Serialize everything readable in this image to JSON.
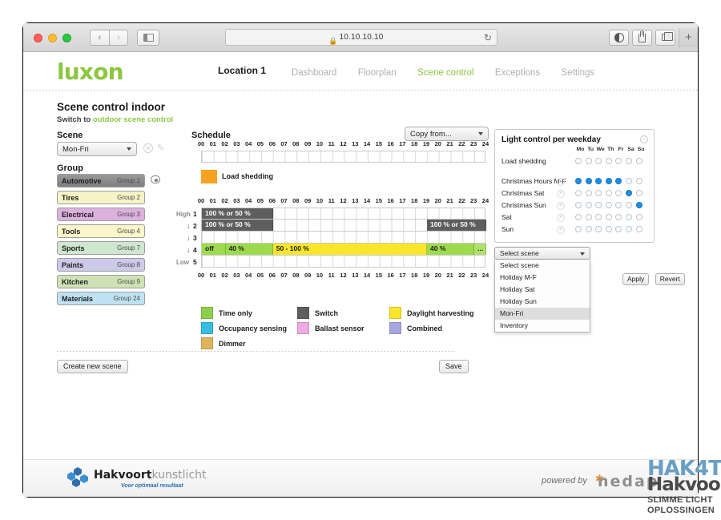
{
  "browser": {
    "url": "10.10.10.10",
    "lock_icon": "lock-icon",
    "reload_icon": "reload-icon",
    "back_icon": "chevron-left-icon",
    "forward_icon": "chevron-right-icon",
    "sidebar_icon": "sidebar-icon",
    "reader_icon": "reader-icon",
    "share_icon": "share-icon",
    "tabs_icon": "tab-overview-icon",
    "newtab_label": "+"
  },
  "header": {
    "logo": "luxon",
    "location": "Location 1",
    "nav": [
      {
        "label": "Dashboard",
        "active": false
      },
      {
        "label": "Floorplan",
        "active": false
      },
      {
        "label": "Scene control",
        "active": true
      },
      {
        "label": "Exceptions",
        "active": false
      },
      {
        "label": "Settings",
        "active": false
      }
    ]
  },
  "page": {
    "title": "Scene control indoor",
    "switch_prefix": "Switch to ",
    "switch_link": "outdoor scene control"
  },
  "scene": {
    "label": "Scene",
    "selected": "Mon-Fri",
    "delete_icon": "close-circle-icon",
    "edit_icon": "pencil-icon"
  },
  "group": {
    "label": "Group",
    "visibility_icon": "eye-icon",
    "items": [
      {
        "name": "Automotive",
        "number": "Group 1",
        "color": "#8c8c8c"
      },
      {
        "name": "Tires",
        "number": "Group 2",
        "color": "#f7f3c8"
      },
      {
        "name": "Electrical",
        "number": "Group 3",
        "color": "#dcb1de"
      },
      {
        "name": "Tools",
        "number": "Group 4",
        "color": "#faf6c9"
      },
      {
        "name": "Sports",
        "number": "Group 7",
        "color": "#cfe6cf"
      },
      {
        "name": "Paints",
        "number": "Group 8",
        "color": "#cdc9ea"
      },
      {
        "name": "Kitchen",
        "number": "Group 9",
        "color": "#cfe2b5"
      },
      {
        "name": "Materials",
        "number": "Group 24",
        "color": "#bfe2f2"
      }
    ]
  },
  "schedule": {
    "label": "Schedule",
    "copy_from": "Copy from...",
    "hours": [
      "00",
      "01",
      "02",
      "03",
      "04",
      "05",
      "06",
      "07",
      "08",
      "09",
      "10",
      "11",
      "12",
      "13",
      "14",
      "15",
      "16",
      "17",
      "18",
      "19",
      "20",
      "21",
      "22",
      "23",
      "24"
    ],
    "load_shedding": {
      "swatch_color": "#f7a321",
      "label": "Load shedding",
      "blocks": []
    },
    "levels": {
      "high_label": "High",
      "low_label": "Low",
      "arrow_icon": "arrow-down-icon",
      "rows": [
        {
          "num": "1",
          "side": "High",
          "arrow": false,
          "blocks": [
            {
              "text": "100 % or 50 %",
              "start": 0,
              "end": 6,
              "style": "dark"
            }
          ]
        },
        {
          "num": "2",
          "side": "",
          "arrow": true,
          "blocks": [
            {
              "text": "100 % or 50 %",
              "start": 0,
              "end": 6,
              "style": "dark"
            },
            {
              "text": "100 % or 50 %",
              "start": 19,
              "end": 24,
              "style": "dark"
            }
          ]
        },
        {
          "num": "3",
          "side": "",
          "arrow": true,
          "blocks": []
        },
        {
          "num": "4",
          "side": "",
          "arrow": true,
          "blocks": [
            {
              "text": "off",
              "start": 0,
              "end": 2,
              "style": "green"
            },
            {
              "text": "40 %",
              "start": 2,
              "end": 6,
              "style": "green"
            },
            {
              "text": "50 - 100 %",
              "start": 6,
              "end": 19,
              "style": "yellow"
            },
            {
              "text": "40 %",
              "start": 19,
              "end": 23,
              "style": "green"
            },
            {
              "text": "...",
              "start": 23,
              "end": 24,
              "style": "greenpale"
            }
          ]
        },
        {
          "num": "5",
          "side": "Low",
          "arrow": false,
          "blocks": []
        }
      ]
    },
    "legend": [
      {
        "label": "Time only",
        "color": "#8ed04a"
      },
      {
        "label": "Switch",
        "color": "#5e5e5e"
      },
      {
        "label": "Daylight harvesting",
        "color": "#f9e62a"
      },
      {
        "label": "Occupancy sensing",
        "color": "#38bde0"
      },
      {
        "label": "Ballast sensor",
        "color": "#eeaae6"
      },
      {
        "label": "Combined",
        "color": "#a7a7e0"
      },
      {
        "label": "Dimmer",
        "color": "#e0b45d"
      }
    ]
  },
  "actions": {
    "create_new_scene": "Create new scene",
    "save": "Save"
  },
  "light_control": {
    "title": "Light control per weekday",
    "collapse_icon": "minus-circle-icon",
    "days": [
      "Mo",
      "Tu",
      "We",
      "Th",
      "Fr",
      "Sa",
      "Su"
    ],
    "rows": [
      {
        "name": "Load shedding",
        "deletable": false,
        "days": [
          false,
          false,
          false,
          false,
          false,
          false,
          false
        ]
      },
      {
        "name": "Christmas Hours M-F",
        "deletable": true,
        "days": [
          true,
          true,
          true,
          true,
          true,
          false,
          false
        ]
      },
      {
        "name": "Christmas Sat",
        "deletable": true,
        "days": [
          false,
          false,
          false,
          false,
          false,
          true,
          false
        ]
      },
      {
        "name": "Christmas Sun",
        "deletable": true,
        "days": [
          false,
          false,
          false,
          false,
          false,
          false,
          true
        ]
      },
      {
        "name": "Sat",
        "deletable": true,
        "days": [
          false,
          false,
          false,
          false,
          false,
          false,
          false
        ]
      },
      {
        "name": "Sun",
        "deletable": true,
        "days": [
          false,
          false,
          false,
          false,
          false,
          false,
          false
        ]
      }
    ],
    "active_dot_color": "#1e8fe8",
    "scene_picker": {
      "selected": "Select scene",
      "options": [
        "Select scene",
        "Holiday M-F",
        "Holiday Sat",
        "Holiday Sun",
        "Mon-Fri",
        "Inventory"
      ],
      "highlighted": "Mon-Fri"
    },
    "apply": "Apply",
    "revert": "Revert"
  },
  "footer": {
    "brand_bold": "Hakvoort",
    "brand_light": "kunstlicht",
    "tagline": "Voor optimaal resultaat",
    "powered_by": "powered by",
    "vendor": "nedap"
  },
  "watermark": {
    "line1": "HAK4T",
    "line2": "Hakvoort",
    "line3": "SLIMME LICHT",
    "line4": "OPLOSSINGEN"
  }
}
